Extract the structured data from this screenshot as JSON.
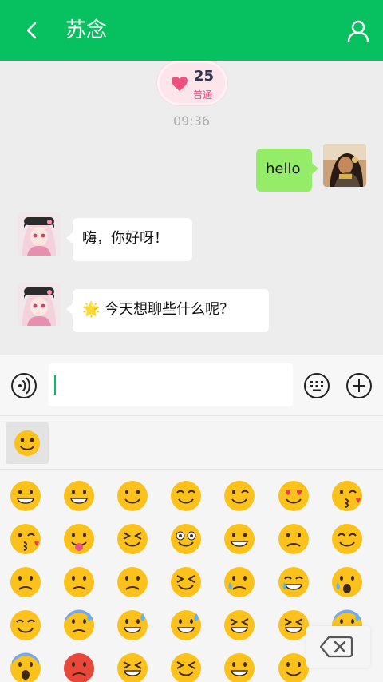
{
  "header": {
    "title": "苏念"
  },
  "intimacy": {
    "level": "25",
    "label": "普通"
  },
  "chat": {
    "timestamp": "09:36",
    "messages": [
      {
        "side": "mine",
        "text": "hello"
      },
      {
        "side": "theirs",
        "text": "嗨，你好呀！"
      },
      {
        "side": "theirs",
        "text": "🌟 今天想聊些什么呢？"
      }
    ]
  },
  "input": {
    "value": ""
  },
  "colors": {
    "brand": "#07c160",
    "mine_bubble": "#95ec69",
    "heart": "#f0507e"
  }
}
